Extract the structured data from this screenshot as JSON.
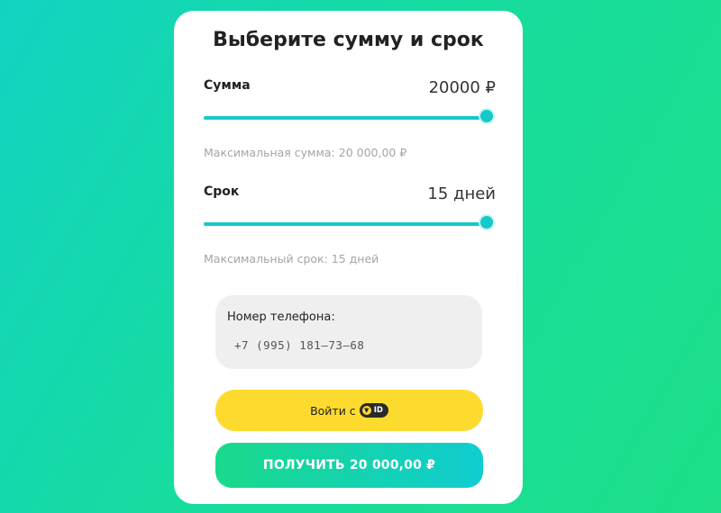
{
  "form": {
    "title": "Выберите сумму и срок",
    "amount": {
      "label": "Сумма",
      "value": "20000 ₽",
      "hint": "Максимальная сумма: 20 000,00 ₽",
      "slider_fraction": 1.0
    },
    "term": {
      "label": "Срок",
      "value": "15 дней",
      "hint": "Максимальный срок: 15 дней",
      "slider_fraction": 1.0
    },
    "phone": {
      "label": "Номер телефона:",
      "value": "+7 (995) 181–73–68"
    },
    "login_button": {
      "label": "Войти с",
      "badge_text": "ID",
      "badge_icon": "shield-icon"
    },
    "submit_button": {
      "label": "ПОЛУЧИТЬ 20 000,00 ₽"
    }
  },
  "colors": {
    "accent": "#15c9c9",
    "login_button": "#fddb2e",
    "submit_gradient_start": "#19d98a",
    "submit_gradient_end": "#10cdd0",
    "background_gradient_start": "#12d3c2",
    "background_gradient_end": "#1ddf88"
  }
}
